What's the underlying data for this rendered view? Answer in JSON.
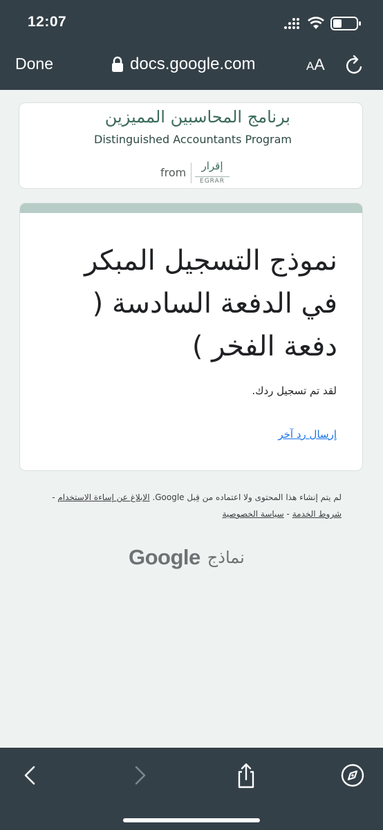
{
  "status_bar": {
    "time": "12:07",
    "icons": [
      "signal-icon",
      "wifi-icon",
      "battery-icon"
    ]
  },
  "browser": {
    "done_label": "Done",
    "url": "docs.google.com",
    "text_size_small": "A",
    "text_size_big": "A",
    "icons": [
      "lock-icon",
      "reload-icon"
    ]
  },
  "header": {
    "arabic_name": "برنامج المحاسبين المميزين",
    "english_name": "Distinguished Accountants Program",
    "from_label": "from",
    "logo_arabic": "إقرار",
    "logo_latin": "EGRAR"
  },
  "form": {
    "title": "نموذج التسجيل المبكر في الدفعة السادسة ( دفعة الفخر )",
    "confirmation": "لقد تم تسجيل ردك.",
    "another_response_link": "إرسال رد آخر"
  },
  "footer": {
    "disclaimer_text": "لم يتم إنشاء هذا المحتوى ولا اعتماده من قِبل Google.",
    "report_abuse_link": "الإبلاغ عن إساءة الاستخدام",
    "separator": "-",
    "terms_link": "شروط الخدمة",
    "privacy_link": "سياسة الخصوصية",
    "google_word": "Google",
    "forms_word": "نماذج"
  },
  "toolbar": {
    "icons": [
      "back-icon",
      "forward-icon",
      "share-icon",
      "compass-icon"
    ]
  },
  "colors": {
    "chrome": "#344048",
    "page_background": "#eef3f1",
    "card_accent": "#b7ccc6",
    "link": "#1a73e8",
    "brand_green": "#3c6b5a"
  }
}
